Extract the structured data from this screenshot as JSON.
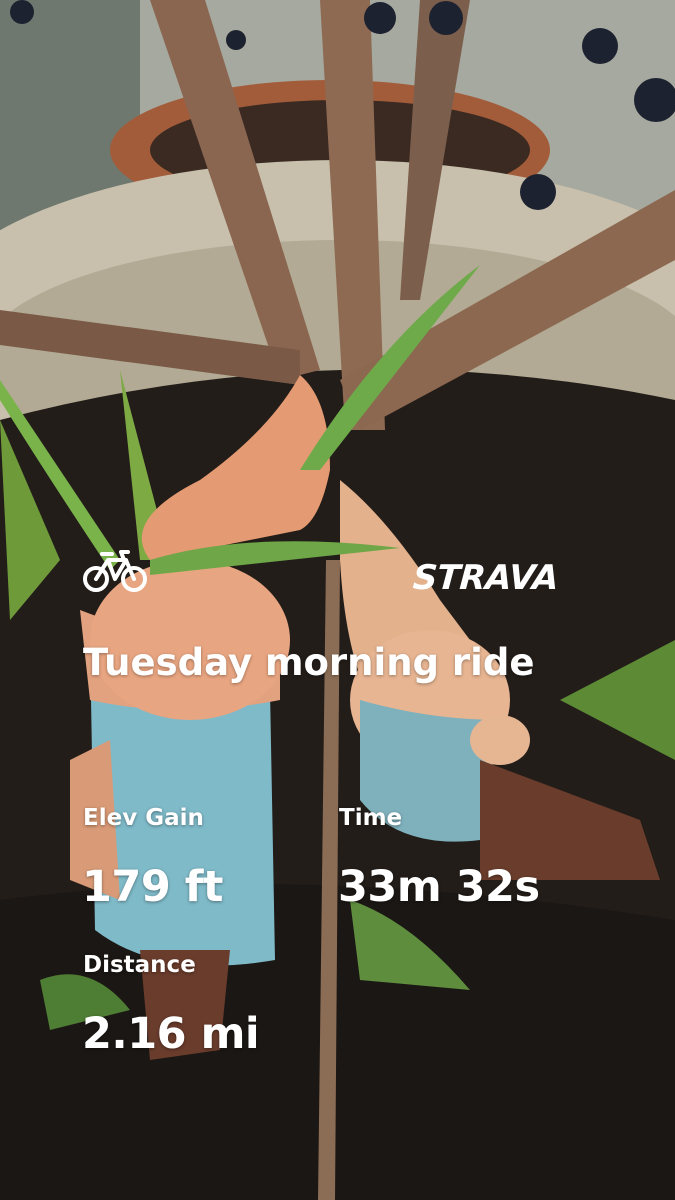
{
  "brand": {
    "name": "STRAVA",
    "color": "#ffffff"
  },
  "activity": {
    "type_icon": "bicycle-icon",
    "title": "Tuesday morning ride"
  },
  "stats": {
    "elev_gain": {
      "label": "Elev Gain",
      "value": "179 ft"
    },
    "time": {
      "label": "Time",
      "value": "33m 32s"
    },
    "distance": {
      "label": "Distance",
      "value": "2.16 mi"
    }
  }
}
